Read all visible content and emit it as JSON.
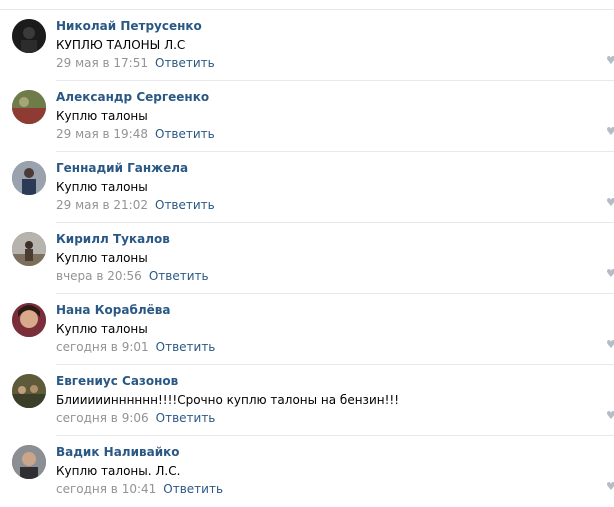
{
  "reply_label": "Ответить",
  "comments": [
    {
      "author": "Николай Петрусенко",
      "text": "КУПЛЮ ТАЛОНЫ Л.С",
      "date": "29 мая в 17:51",
      "avatar_icon": "avatar-photo-dark"
    },
    {
      "author": "Александр Сергеенко",
      "text": "Куплю талоны",
      "date": "29 мая в 19:48",
      "avatar_icon": "avatar-photo-car"
    },
    {
      "author": "Геннадий Ганжела",
      "text": "Куплю талоны",
      "date": "29 мая в 21:02",
      "avatar_icon": "avatar-photo-person"
    },
    {
      "author": "Кирилл Тукалов",
      "text": "Куплю талоны",
      "date": "вчера в 20:56",
      "avatar_icon": "avatar-photo-outdoor"
    },
    {
      "author": "Нана Кораблёва",
      "text": "Куплю талоны",
      "date": "сегодня в 9:01",
      "avatar_icon": "avatar-photo-woman"
    },
    {
      "author": "Евгениус Сазонов",
      "text": "Блииииинннннн!!!!Срочно куплю талоны на бензин!!!",
      "date": "сегодня в 9:06",
      "avatar_icon": "avatar-photo-group"
    },
    {
      "author": "Вадик Наливайко",
      "text": "Куплю талоны. Л.С.",
      "date": "сегодня в 10:41",
      "avatar_icon": "avatar-photo-man"
    }
  ],
  "colors": {
    "link": "#2a5885",
    "date": "#939393",
    "separator": "#e7e8ec"
  }
}
